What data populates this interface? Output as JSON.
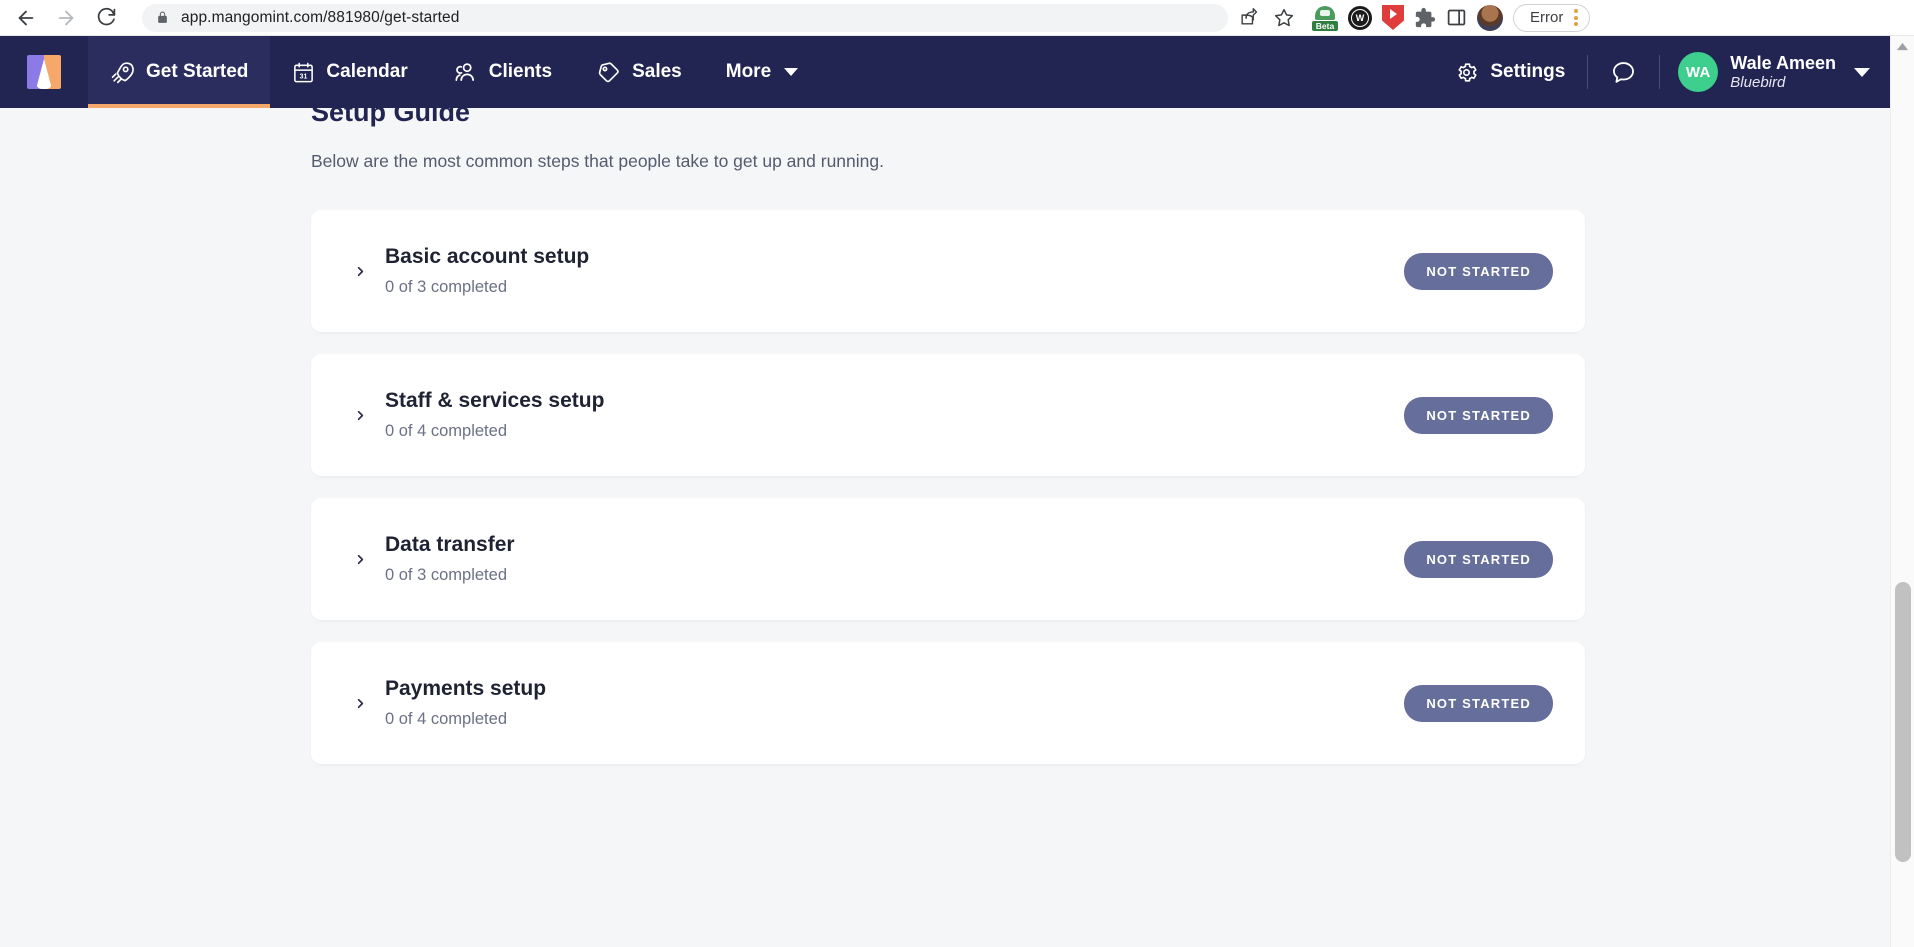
{
  "browser": {
    "back_label": "back-arrow",
    "forward_label": "forward-arrow",
    "reload_label": "reload",
    "url_prefix": "app.mangomint.com",
    "url_path": "/881980/get-started",
    "url_full": "app.mangomint.com/881980/get-started",
    "extensions": [
      {
        "name": "beta-extension",
        "label": "Beta"
      },
      {
        "name": "wallet-extension",
        "label": "W"
      },
      {
        "name": "video-download-extension",
        "label": ""
      },
      {
        "name": "extensions-puzzle",
        "label": ""
      },
      {
        "name": "side-panel",
        "label": ""
      },
      {
        "name": "profile-avatar",
        "label": ""
      }
    ],
    "error_button": "Error"
  },
  "nav": {
    "logo": "mangomint-logo",
    "items": [
      {
        "label": "Get Started",
        "icon": "rocket-icon",
        "active": true
      },
      {
        "label": "Calendar",
        "icon": "calendar-icon",
        "active": false
      },
      {
        "label": "Clients",
        "icon": "clients-icon",
        "active": false
      },
      {
        "label": "Sales",
        "icon": "tag-icon",
        "active": false
      },
      {
        "label": "More",
        "icon": "chevron-down-icon",
        "active": false
      }
    ],
    "settings_label": "Settings",
    "chat_icon": "chat-bubble-icon",
    "user": {
      "initials": "WA",
      "name": "Wale Ameen",
      "org": "Bluebird"
    }
  },
  "main": {
    "title": "Setup Guide",
    "subtitle": "Below are the most common steps that people take to get up and running.",
    "cards": [
      {
        "title": "Basic account setup",
        "progress": "0 of 3 completed",
        "status": "NOT STARTED"
      },
      {
        "title": "Staff & services setup",
        "progress": "0 of 4 completed",
        "status": "NOT STARTED"
      },
      {
        "title": "Data transfer",
        "progress": "0 of 3 completed",
        "status": "NOT STARTED"
      },
      {
        "title": "Payments setup",
        "progress": "0 of 4 completed",
        "status": "NOT STARTED"
      }
    ]
  },
  "colors": {
    "nav_bg": "#222452",
    "accent": "#f5a86a",
    "badge": "#666e9c",
    "avatar": "#3ecf8e",
    "page_bg": "#f5f6f8"
  }
}
